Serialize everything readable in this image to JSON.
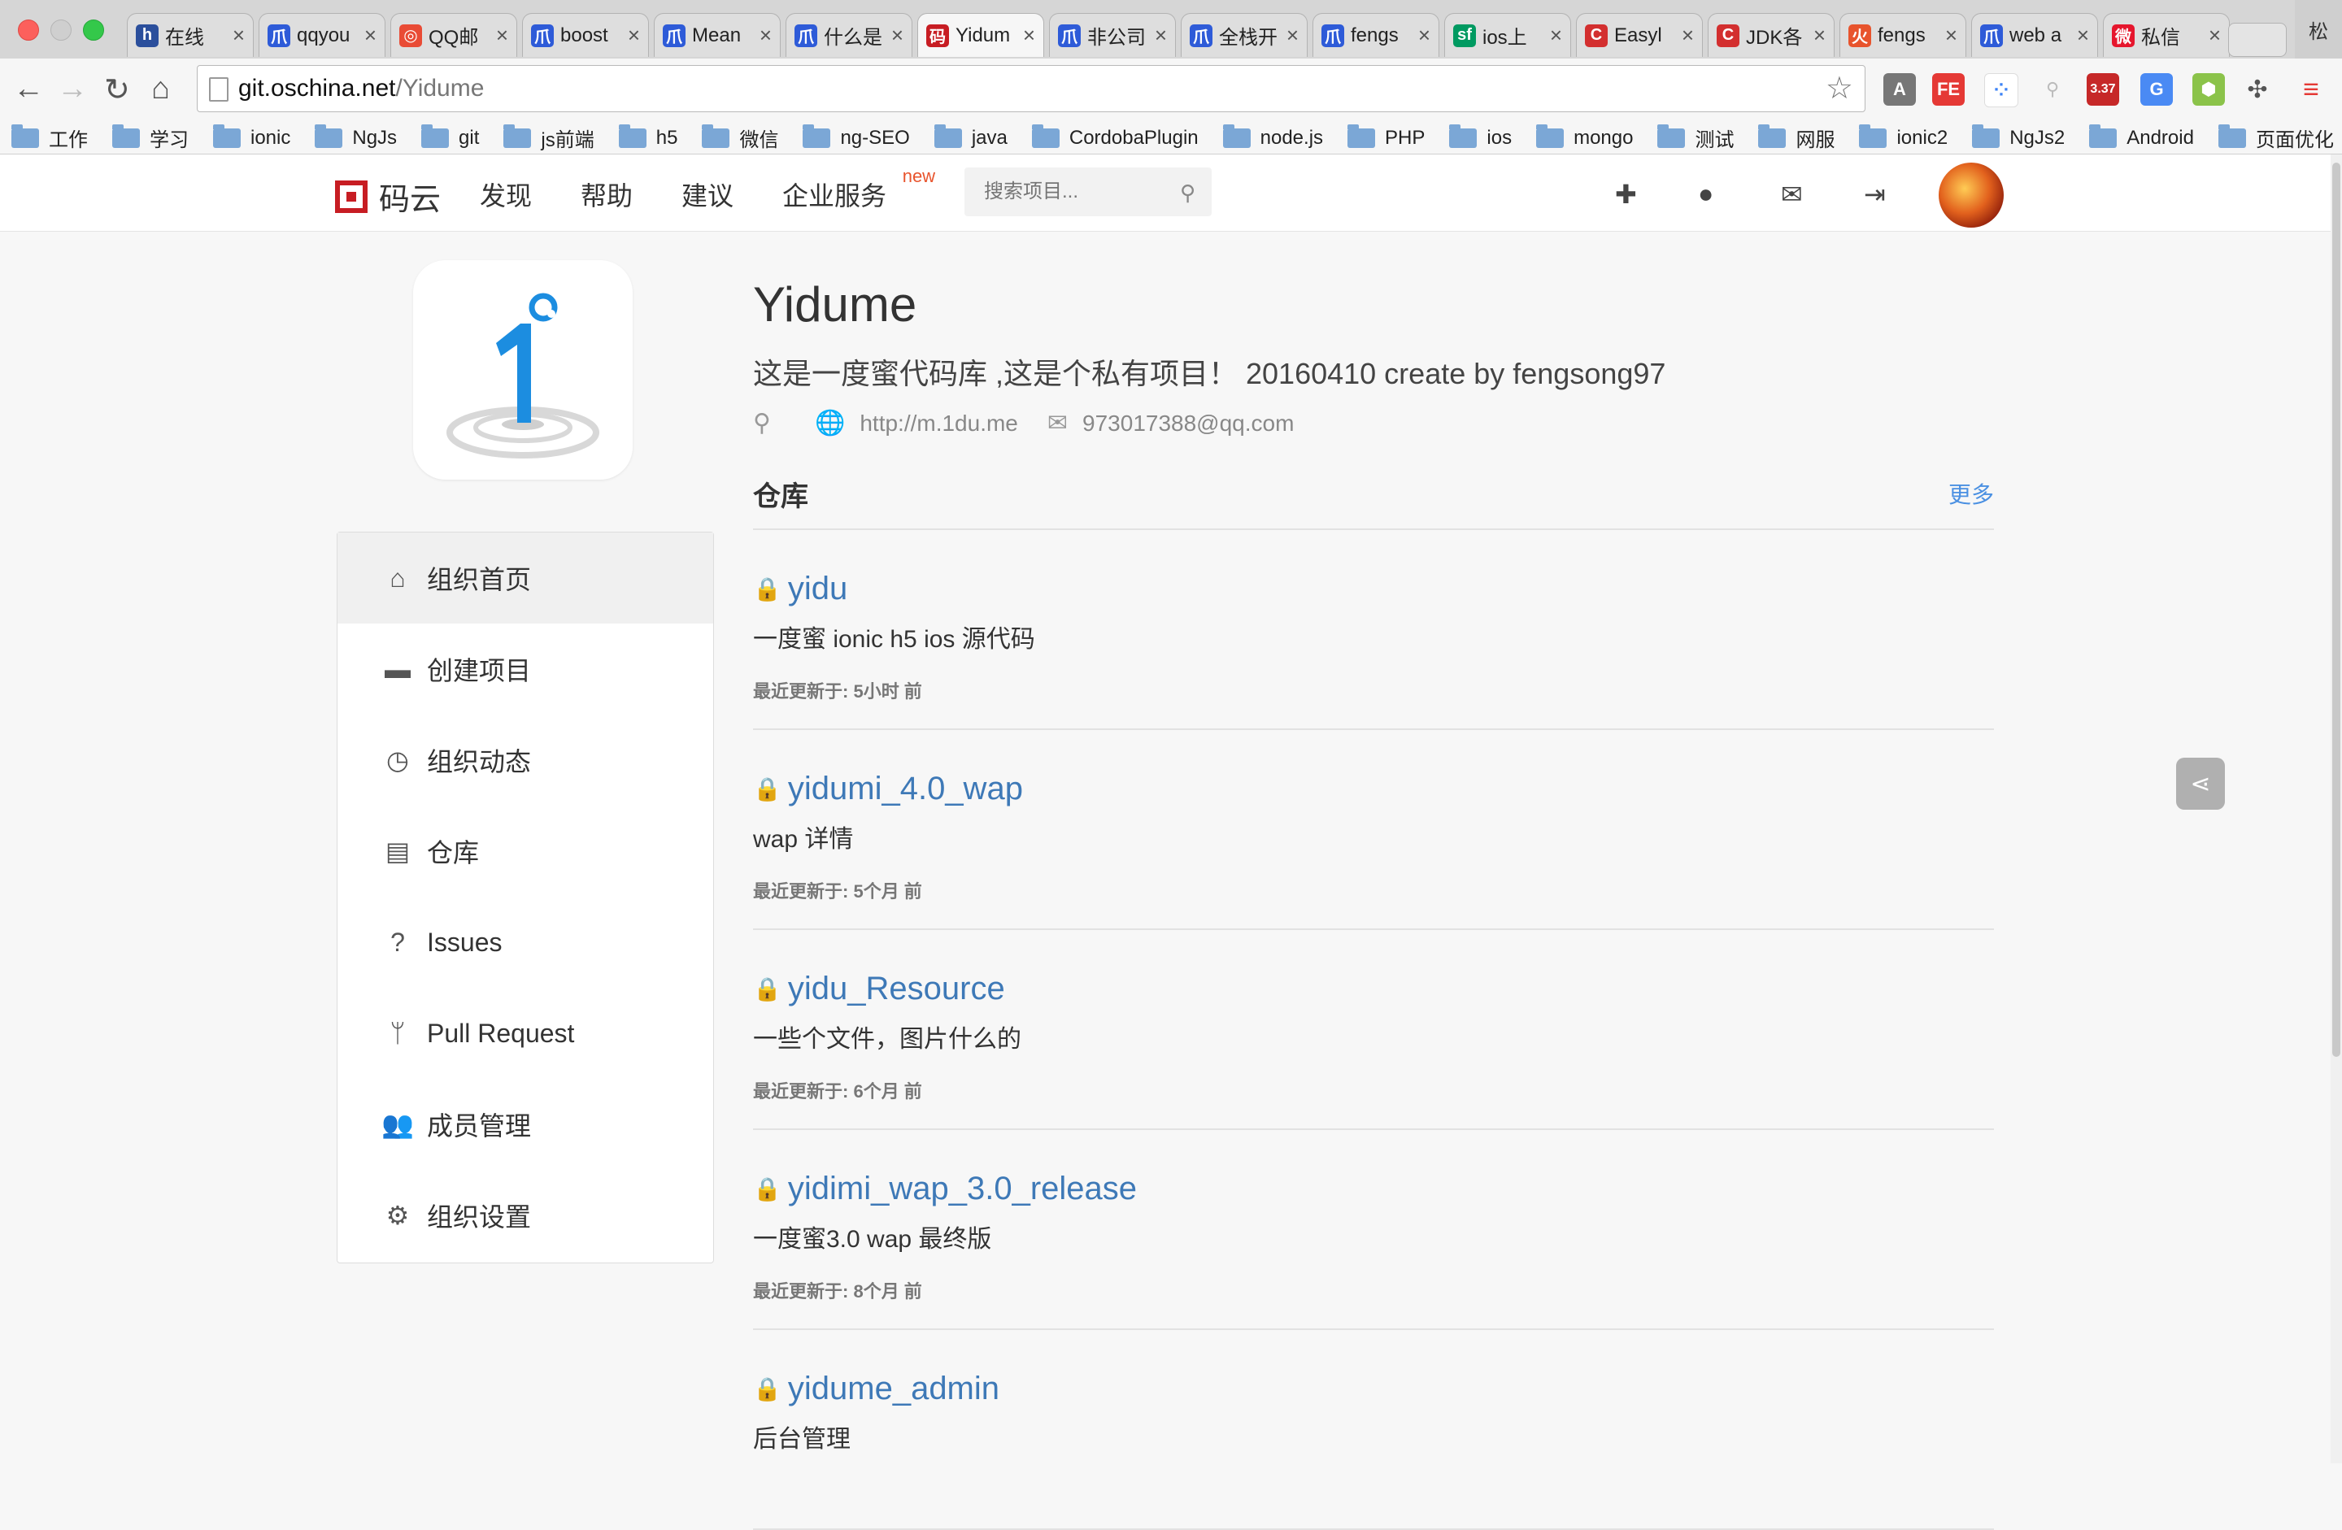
{
  "browser": {
    "tabs": [
      {
        "label": "在线",
        "fav": "h",
        "color": "#2b4f9c"
      },
      {
        "label": "qqyou",
        "fav": "爪",
        "color": "#2e5bd8"
      },
      {
        "label": "QQ邮",
        "fav": "◎",
        "color": "#e94b35"
      },
      {
        "label": "boost",
        "fav": "爪",
        "color": "#2e5bd8"
      },
      {
        "label": "Mean",
        "fav": "爪",
        "color": "#2e5bd8"
      },
      {
        "label": "什么是",
        "fav": "爪",
        "color": "#2e5bd8"
      },
      {
        "label": "Yidum",
        "fav": "码",
        "color": "#c71d23",
        "active": true
      },
      {
        "label": "非公司",
        "fav": "爪",
        "color": "#2e5bd8"
      },
      {
        "label": "全栈开",
        "fav": "爪",
        "color": "#2e5bd8"
      },
      {
        "label": "fengs",
        "fav": "爪",
        "color": "#2e5bd8"
      },
      {
        "label": "ios上",
        "fav": "sf",
        "color": "#009a61"
      },
      {
        "label": "Easyl",
        "fav": "C",
        "color": "#d32f2f"
      },
      {
        "label": "JDK各",
        "fav": "C",
        "color": "#d32f2f"
      },
      {
        "label": "fengs",
        "fav": "火",
        "color": "#e8542d"
      },
      {
        "label": "web a",
        "fav": "爪",
        "color": "#2e5bd8"
      },
      {
        "label": "私信",
        "fav": "微",
        "color": "#e6162d"
      }
    ],
    "close_glyph": "×",
    "profile_label": "松",
    "url_host": "git.oschina.net",
    "url_path": "/Yidume",
    "ext_badge": "3.37",
    "bookmarks": [
      "工作",
      "学习",
      "ionic",
      "NgJs",
      "git",
      "js前端",
      "h5",
      "微信",
      "ng-SEO",
      "java",
      "CordobaPlugin",
      "node.js",
      "PHP",
      "ios",
      "mongo",
      "测试",
      "网服",
      "ionic2",
      "NgJs2",
      "Android",
      "页面优化"
    ]
  },
  "site": {
    "logo_text": "码云",
    "nav": [
      "发现",
      "帮助",
      "建议",
      "企业服务"
    ],
    "nav_badge": "new",
    "search_placeholder": "搜索项目..."
  },
  "org": {
    "name": "Yidume",
    "description": "这是一度蜜代码库 ,这是个私有项目！ 20160410 create by fengsong97",
    "website": "http://m.1du.me",
    "email": "973017388@qq.com"
  },
  "sidebar": {
    "items": [
      {
        "label": "组织首页",
        "icon": "home-icon",
        "glyph": "⌂"
      },
      {
        "label": "创建项目",
        "icon": "folder-icon",
        "glyph": "▬"
      },
      {
        "label": "组织动态",
        "icon": "clock-icon",
        "glyph": "◷"
      },
      {
        "label": "仓库",
        "icon": "archive-icon",
        "glyph": "▤"
      },
      {
        "label": "Issues",
        "icon": "question-icon",
        "glyph": "?"
      },
      {
        "label": "Pull Request",
        "icon": "branch-icon",
        "glyph": "ᛘ"
      },
      {
        "label": "成员管理",
        "icon": "users-icon",
        "glyph": "👥"
      },
      {
        "label": "组织设置",
        "icon": "gear-icon",
        "glyph": "⚙"
      }
    ]
  },
  "repos_section": {
    "title": "仓库",
    "more": "更多",
    "updated_prefix": "最近更新于: ",
    "items": [
      {
        "name": "yidu",
        "desc": "一度蜜 ionic h5 ios 源代码",
        "updated": "5小时 前"
      },
      {
        "name": "yidumi_4.0_wap",
        "desc": "wap 详情",
        "updated": "5个月 前"
      },
      {
        "name": "yidu_Resource",
        "desc": "一些个文件，图片什么的",
        "updated": "6个月 前"
      },
      {
        "name": "yidimi_wap_3.0_release",
        "desc": "一度蜜3.0 wap 最终版",
        "updated": "8个月 前"
      },
      {
        "name": "yidume_admin",
        "desc": "后台管理",
        "updated": ""
      }
    ]
  }
}
